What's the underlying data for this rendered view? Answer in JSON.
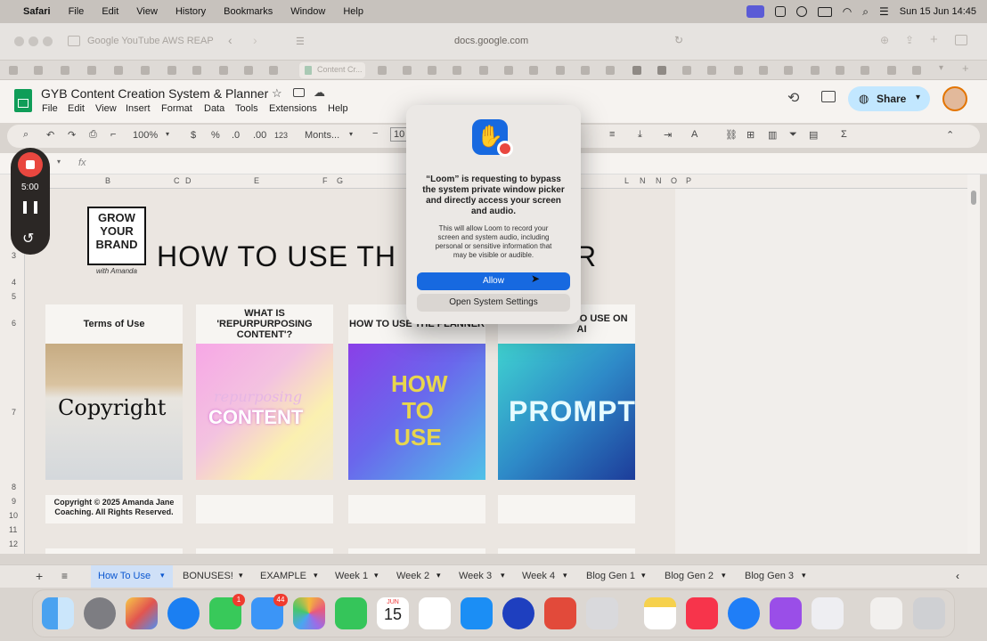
{
  "menubar": {
    "app": "Safari",
    "items": [
      "File",
      "Edit",
      "View",
      "History",
      "Bookmarks",
      "Window",
      "Help"
    ],
    "clock": "Sun 15 Jun  14:45"
  },
  "safari": {
    "tab_group": "Google YouTube AWS REAP",
    "url": "docs.google.com",
    "active_tab": "Content Cr..."
  },
  "doc": {
    "title": "GYB Content Creation System & Planner",
    "menus": [
      "File",
      "Edit",
      "View",
      "Insert",
      "Format",
      "Data",
      "Tools",
      "Extensions",
      "Help"
    ],
    "share_label": "Share"
  },
  "toolbar": {
    "zoom": "100%",
    "currency": "$",
    "percent": "%",
    "dec_minus": ".0",
    "dec_plus": ".00",
    "num_format": "123",
    "font": "Monts...",
    "font_size": "10",
    "sum": "Σ"
  },
  "formula": {
    "fx": "fx"
  },
  "columns": [
    "B",
    "C",
    "D",
    "E",
    "F",
    "G",
    "L",
    "N",
    "N",
    "O",
    "P"
  ],
  "rows": [
    "3",
    "4",
    "5",
    "6",
    "7",
    "8",
    "9",
    "10",
    "11",
    "12"
  ],
  "sheet": {
    "logo_lines": [
      "GROW",
      "YOUR",
      "BRAND"
    ],
    "logo_sub": "with Amanda",
    "heading": "HOW TO USE TH",
    "heading_tail": "R",
    "cards": [
      {
        "title": "Terms of Use",
        "image_text": "Copyright"
      },
      {
        "title": "WHAT IS 'REPURPURPOSING CONTENT'?",
        "image_text": "CONTENT",
        "image_sub": "repurposing"
      },
      {
        "title": "HOW TO USE THE PLANNER",
        "image_text": "HOW TO USE"
      },
      {
        "title": "ROMPT TO USE ON AI",
        "image_text": "PROMPT"
      }
    ],
    "copyright": "Copyright © 2025 Amanda Jane Coaching. All Rights Reserved."
  },
  "loom": {
    "timer": "5:00"
  },
  "dialog": {
    "title": "“Loom” is requesting to bypass the system private window picker and directly access your screen and audio.",
    "body": "This will allow Loom to record your screen and system audio, including personal or sensitive information that may be visible or audible.",
    "allow": "Allow",
    "settings": "Open System Settings"
  },
  "sheet_tabs": [
    "How To Use",
    "BONUSES!",
    "EXAMPLE",
    "Week 1",
    "Week 2",
    "Week 3",
    "Week 4",
    "Blog Gen 1",
    "Blog Gen 2",
    "Blog Gen 3"
  ],
  "dock": {
    "calendar_month": "JUN",
    "calendar_day": "15",
    "messages_badge": "1",
    "mail_badge": "44"
  },
  "colors": {
    "accent": "#1a73e8",
    "share_bg": "#c2e7ff",
    "sheets_green": "#0f9d58",
    "dialog_blue": "#1769e0",
    "loom_red": "#e9473f"
  },
  "icons": [
    "apple-icon",
    "wifi-icon",
    "search-icon",
    "battery-icon",
    "history-icon",
    "comment-icon",
    "globe-icon",
    "star-icon",
    "hand-icon",
    "record-icon",
    "pause-icon",
    "restart-icon",
    "stop-icon"
  ]
}
